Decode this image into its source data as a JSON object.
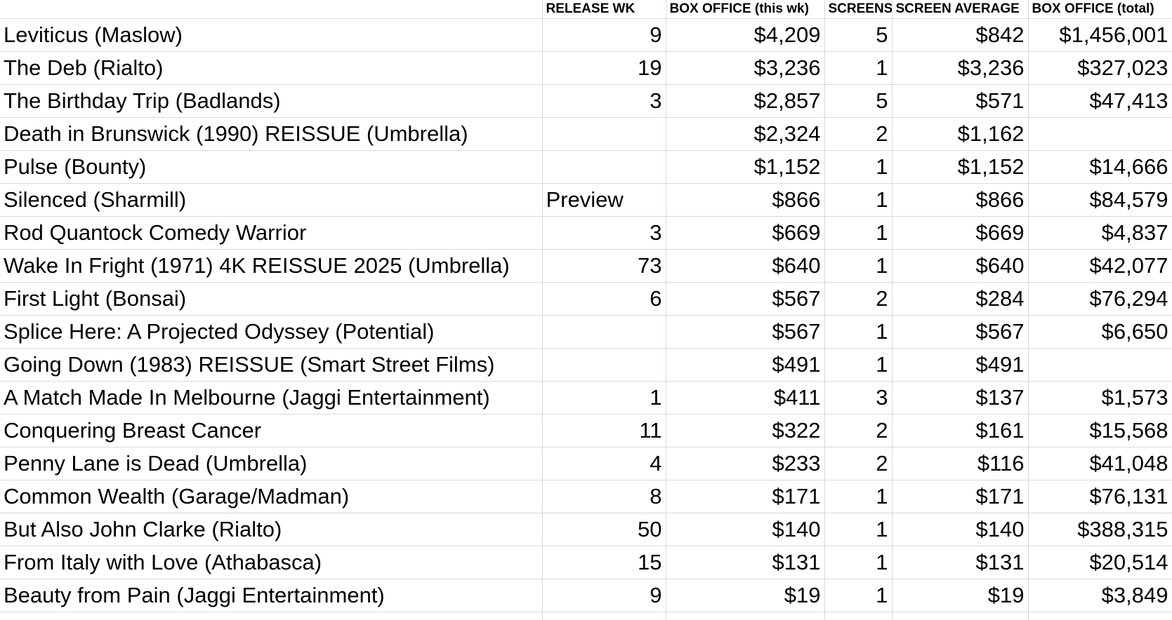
{
  "columns": [
    "",
    "RELEASE WK",
    "BOX OFFICE (this wk)",
    "SCREENS",
    "SCREEN AVERAGE",
    "BOX OFFICE (total)"
  ],
  "rows": [
    [
      "Leviticus (Maslow)",
      "9",
      "$4,209",
      "5",
      "$842",
      "$1,456,001"
    ],
    [
      "The Deb (Rialto)",
      "19",
      "$3,236",
      "1",
      "$3,236",
      "$327,023"
    ],
    [
      "The Birthday Trip (Badlands)",
      "3",
      "$2,857",
      "5",
      "$571",
      "$47,413"
    ],
    [
      "Death in Brunswick (1990) REISSUE (Umbrella)",
      "",
      "$2,324",
      "2",
      "$1,162",
      ""
    ],
    [
      "Pulse (Bounty)",
      "",
      "$1,152",
      "1",
      "$1,152",
      "$14,666"
    ],
    [
      "Silenced (Sharmill)",
      "Preview",
      "$866",
      "1",
      "$866",
      "$84,579"
    ],
    [
      "Rod Quantock Comedy Warrior",
      "3",
      "$669",
      "1",
      "$669",
      "$4,837"
    ],
    [
      "Wake In Fright (1971) 4K REISSUE 2025 (Umbrella)",
      "73",
      "$640",
      "1",
      "$640",
      "$42,077"
    ],
    [
      "First Light (Bonsai)",
      "6",
      "$567",
      "2",
      "$284",
      "$76,294"
    ],
    [
      "Splice Here: A Projected Odyssey (Potential)",
      "",
      "$567",
      "1",
      "$567",
      "$6,650"
    ],
    [
      "Going Down (1983) REISSUE (Smart Street Films)",
      "",
      "$491",
      "1",
      "$491",
      ""
    ],
    [
      "A Match Made In Melbourne (Jaggi Entertainment)",
      "1",
      "$411",
      "3",
      "$137",
      "$1,573"
    ],
    [
      "Conquering Breast Cancer",
      "11",
      "$322",
      "2",
      "$161",
      "$15,568"
    ],
    [
      "Penny Lane is Dead (Umbrella)",
      "4",
      "$233",
      "2",
      "$116",
      "$41,048"
    ],
    [
      "Common Wealth (Garage/Madman)",
      "8",
      "$171",
      "1",
      "$171",
      "$76,131"
    ],
    [
      "But Also John Clarke (Rialto)",
      "50",
      "$140",
      "1",
      "$140",
      "$388,315"
    ],
    [
      "From Italy with Love (Athabasca)",
      "15",
      "$131",
      "1",
      "$131",
      "$20,514"
    ],
    [
      "Beauty from Pain (Jaggi Entertainment)",
      "9",
      "$19",
      "1",
      "$19",
      "$3,849"
    ]
  ]
}
